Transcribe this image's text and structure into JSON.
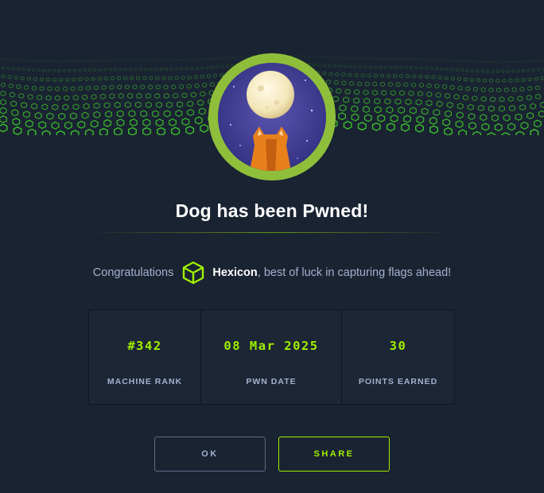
{
  "title": "Dog has been Pwned!",
  "congrats": {
    "prefix": "Congratulations",
    "username": "Hexicon",
    "suffix": ", best of luck in capturing flags ahead!"
  },
  "stats": [
    {
      "value": "#342",
      "label": "MACHINE RANK"
    },
    {
      "value": "08 Mar 2025",
      "label": "PWN DATE"
    },
    {
      "value": "30",
      "label": "POINTS EARNED"
    }
  ],
  "buttons": {
    "ok": "OK",
    "share": "SHARE"
  },
  "icons": {
    "user_rank": "hexagon-cube-icon",
    "machine": "dog-avatar-icon"
  },
  "colors": {
    "background": "#1a2332",
    "accent": "#9fef00",
    "avatar_ring": "#8fbf3a",
    "muted_text": "#a4b1cd"
  }
}
